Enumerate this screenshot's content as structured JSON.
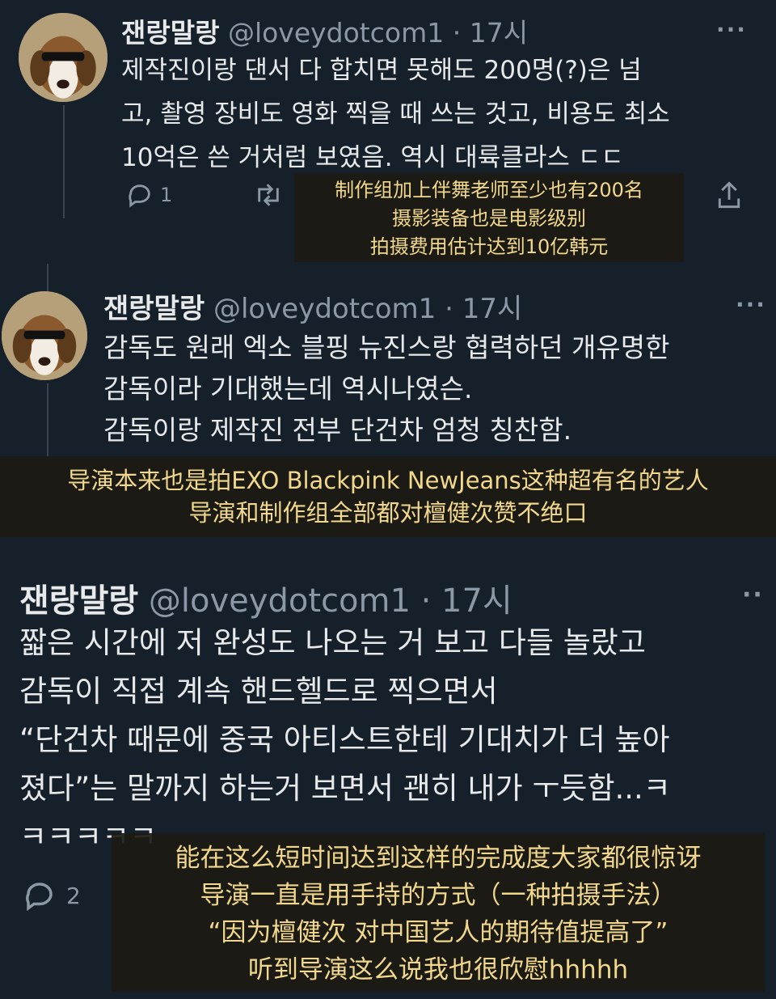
{
  "tweets": [
    {
      "name": "잰랑말랑",
      "handle": "@loveydotcom1",
      "dot": "·",
      "time": "17시",
      "lines": [
        "제작진이랑 댄서 다 합치면 못해도 200명(?)은 넘",
        "고, 촬영 장비도 영화 찍을 때 쓰는 것고, 비용도 최소",
        "10억은 쓴 거처럼 보였음. 역시 대륙클라스 ㄷㄷ"
      ],
      "reply_count": "1",
      "translation": [
        "制作组加上伴舞老师至少也有200名",
        "摄影装备也是电影级别",
        "拍摄费用估计达到10亿韩元"
      ]
    },
    {
      "name": "잰랑말랑",
      "handle": "@loveydotcom1",
      "dot": "·",
      "time": "17시",
      "lines": [
        "감독도 원래 엑소 블핑 뉴진스랑 협력하던 개유명한",
        "감독이라 기대했는데 역시나였슨.",
        "감독이랑 제작진 전부 단건차 엄청 칭찬함."
      ],
      "translation": [
        "导演本来也是拍EXO Blackpink NewJeans这种超有名的艺人",
        "导演和制作组全部都对檀健次赞不绝口"
      ]
    },
    {
      "name": "잰랑말랑",
      "handle": "@loveydotcom1",
      "dot": "·",
      "time": "17시",
      "lines": [
        "짧은 시간에 저 완성도 나오는 거 보고 다들 놀랐고",
        "감독이 직접 계속 핸드헬드로 찍으면서",
        "“단건차 때문에 중국 아티스트한테 기대치가 더 높아",
        "졌다”는 말까지 하는거 보면서 괜히 내가 ㅜ듯함...ㅋ",
        "ㅋㅋㅋㅋㅋ"
      ],
      "reply_count": "2",
      "translation": [
        "能在这么短时间达到这样的完成度大家都很惊讶",
        "导演一直是用手持的方式（一种拍摄手法）",
        "“因为檀健次 对中国艺人的期待值提高了”",
        "听到导演这么说我也很欣慰hhhhh"
      ]
    }
  ],
  "more_glyph": "···",
  "more_glyph_short": "··",
  "icons": [
    "reply-icon",
    "retweet-icon",
    "share-icon",
    "more-icon"
  ],
  "colors": {
    "background": "#15202b",
    "text": "#e7e9ea",
    "muted": "#8b98a5",
    "overlay_text": "#f2d88c"
  }
}
